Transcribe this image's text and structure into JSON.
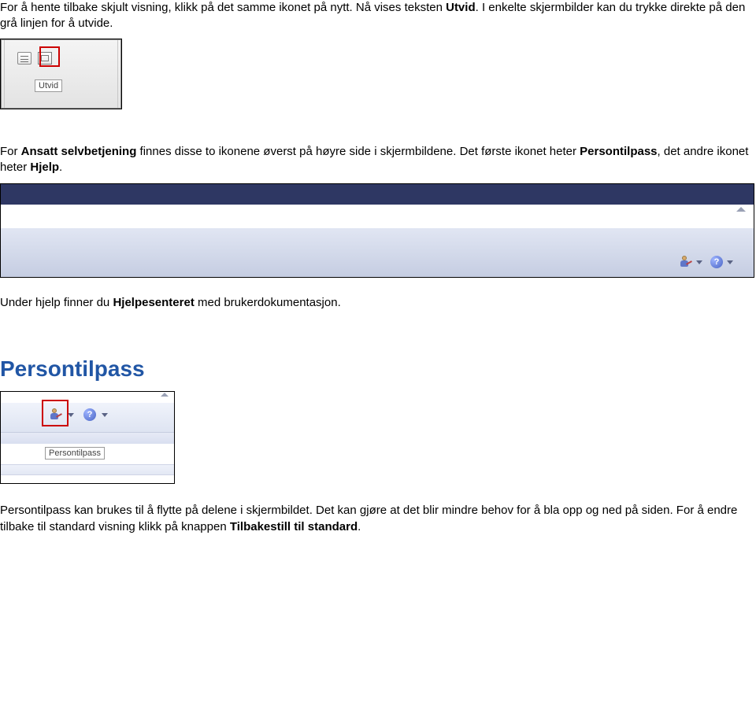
{
  "para1": {
    "t1": "For å hente tilbake skjult visning, klikk på det samme ikonet på nytt. Nå vises teksten ",
    "bold1": "Utvid",
    "t2": ". I enkelte skjermbilder kan du trykke direkte på den grå linjen for å utvide."
  },
  "shot1": {
    "tooltip": "Utvid",
    "icon_list": "list-icon",
    "icon_expand": "expand-icon"
  },
  "para2": {
    "t1": "For ",
    "bold1": "Ansatt selvbetjening",
    "t2": " finnes disse to ikonene øverst på høyre side i skjermbildene. Det første ikonet heter ",
    "bold2": "Persontilpass",
    "t3": ", det andre ikonet heter ",
    "bold3": "Hjelp",
    "t4": "."
  },
  "shot2": {
    "icon_person": "persontilpass-icon",
    "icon_help": "hjelp-icon",
    "help_glyph": "?",
    "collapse": "collapse-icon"
  },
  "para3": {
    "t1": "Under hjelp finner du ",
    "bold1": "Hjelpesenteret",
    "t2": " med brukerdokumentasjon."
  },
  "heading": "Persontilpass",
  "shot3": {
    "tooltip": "Persontilpass",
    "icon_person": "persontilpass-icon",
    "icon_help": "hjelp-icon",
    "help_glyph": "?",
    "collapse": "collapse-icon"
  },
  "para4": {
    "t1": "Persontilpass kan brukes til å flytte på delene i skjermbildet. Det kan gjøre at det blir mindre behov for å bla opp og ned på siden. For å endre tilbake til standard visning klikk på knappen ",
    "bold1": "Tilbakestill til standard",
    "t2": "."
  }
}
